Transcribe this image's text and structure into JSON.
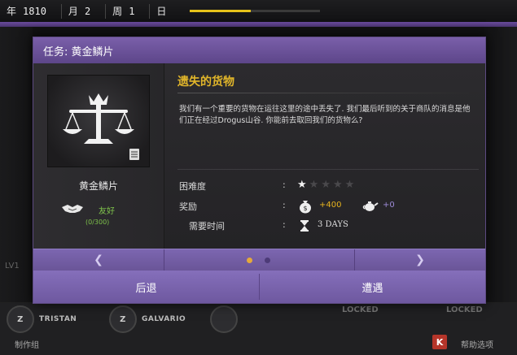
{
  "topbar": {
    "year_label": "年",
    "year_value": "1810",
    "month_label": "月",
    "month_value": "2",
    "week_label": "周",
    "week_value": "1",
    "day_label": "日",
    "day_progress": 0.47,
    "progress_color": "#e6c21a"
  },
  "dialog": {
    "title": "任务: 黄金鳞片",
    "faction": {
      "name": "黄金鳞片",
      "emblem_icon": "balance-scales-icon",
      "relation_icon": "handshake-icon",
      "relation_label": "友好",
      "relation_progress": "(0/300)"
    },
    "quest": {
      "title": "遗失的货物",
      "description": "我们有一个重要的货物在运往这里的途中丢失了. 我们最后听到的关于商队的消息是他们正在经过Drogus山谷. 你能前去取回我们的货物么?",
      "difficulty_label": "困难度",
      "difficulty_rating": 1,
      "difficulty_max": 5,
      "reward_label": "奖励",
      "reward_gold_icon": "money-bag-icon",
      "reward_gold": "+400",
      "reward_influence_icon": "teapot-icon",
      "reward_influence": "+0",
      "time_label": "需要时间",
      "time_icon": "hourglass-icon",
      "time_value": "3 DAYS",
      "colon": ":"
    },
    "pager": {
      "prev_icon": "chevron-left-icon",
      "next_icon": "chevron-right-icon",
      "pages": 2,
      "current_page": 1
    },
    "buttons": {
      "back": "后退",
      "accept": "遭遇"
    }
  },
  "background": {
    "lv_label": "LV1",
    "slots": [
      {
        "name": "TRISTAN",
        "badge": "Z"
      },
      {
        "name": "GALVARIO",
        "badge": "Z"
      },
      {
        "name": "",
        "badge": ""
      }
    ],
    "locked_1": "LOCKED",
    "locked_2": "LOCKED",
    "bottom_left": "制作组",
    "bottom_right": "帮助选项",
    "k_badge": "K"
  },
  "colors": {
    "accent_purple": "#6a5598",
    "quest_title_gold": "#e2b62a",
    "friendly_green": "#7ec24b"
  }
}
